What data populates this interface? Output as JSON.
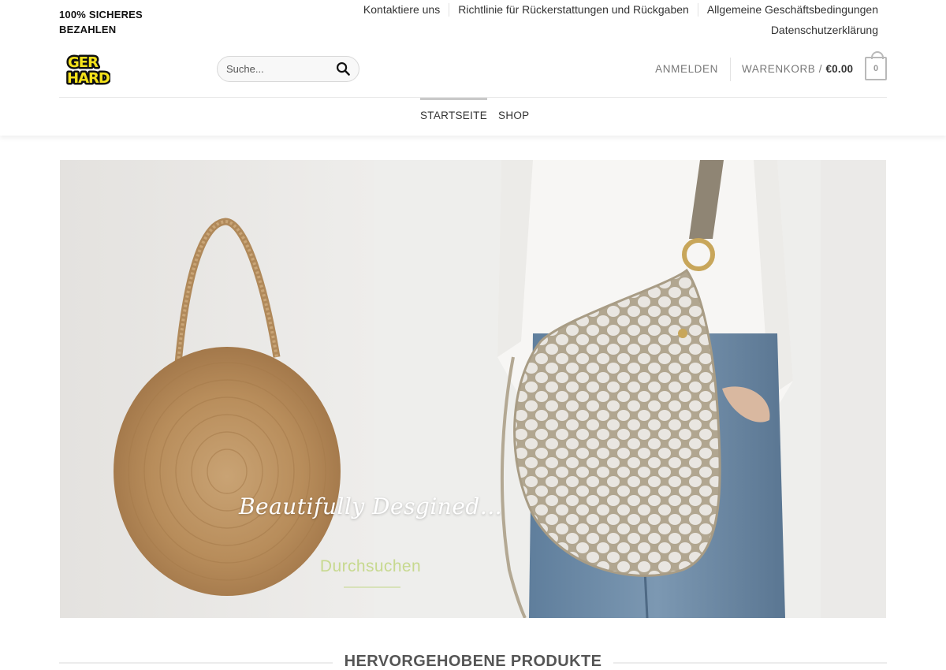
{
  "header": {
    "secure_badge": "100% SICHERES BEZAHLEN",
    "top_links": [
      {
        "label": "Kontaktiere uns"
      },
      {
        "label": "Richtlinie für Rückerstattungen und Rückgaben"
      },
      {
        "label": "Allgemeine Geschäftsbedingungen"
      },
      {
        "label": "Datenschutzerklärung"
      }
    ],
    "logo": {
      "line1": "GER",
      "line2": "HARD",
      "color": "#f5e21a"
    },
    "search": {
      "placeholder": "Suche..."
    },
    "account_label": "ANMELDEN",
    "cart": {
      "label": "WARENKORB /",
      "amount": "€0.00",
      "count": "0"
    },
    "main_nav": [
      {
        "label": "STARTSEITE",
        "active": true
      },
      {
        "label": "SHOP",
        "active": false
      }
    ]
  },
  "hero": {
    "tagline": "Beautifully Desgined...",
    "cta_label": "Durchsuchen",
    "cta_color": "#c7d98f"
  },
  "featured": {
    "heading": "HERVORGEHOBENE PRODUKTE"
  }
}
